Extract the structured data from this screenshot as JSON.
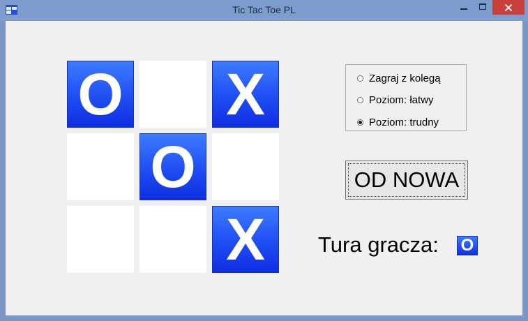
{
  "window": {
    "title": "Tic Tac Toe PL",
    "controls": {
      "minimize": "−",
      "maximize": "□",
      "close": "✕"
    }
  },
  "board": {
    "cells": [
      "O",
      "",
      "X",
      "",
      "O",
      "",
      "",
      "",
      "X"
    ]
  },
  "mode": {
    "options": [
      {
        "label": "Zagraj z kolegą",
        "checked": false
      },
      {
        "label": "Poziom: łatwy",
        "checked": false
      },
      {
        "label": "Poziom: trudny",
        "checked": true
      }
    ]
  },
  "reset_label": "OD NOWA",
  "turn": {
    "label": "Tura gracza:",
    "player": "O"
  },
  "colors": {
    "tile_blue": "#1f4df2",
    "close_red": "#c7403c",
    "background": "#f0f0f0"
  },
  "icons": {
    "app": "app-window-icon",
    "minimize": "minimize-icon",
    "maximize": "maximize-icon",
    "close": "close-icon"
  }
}
